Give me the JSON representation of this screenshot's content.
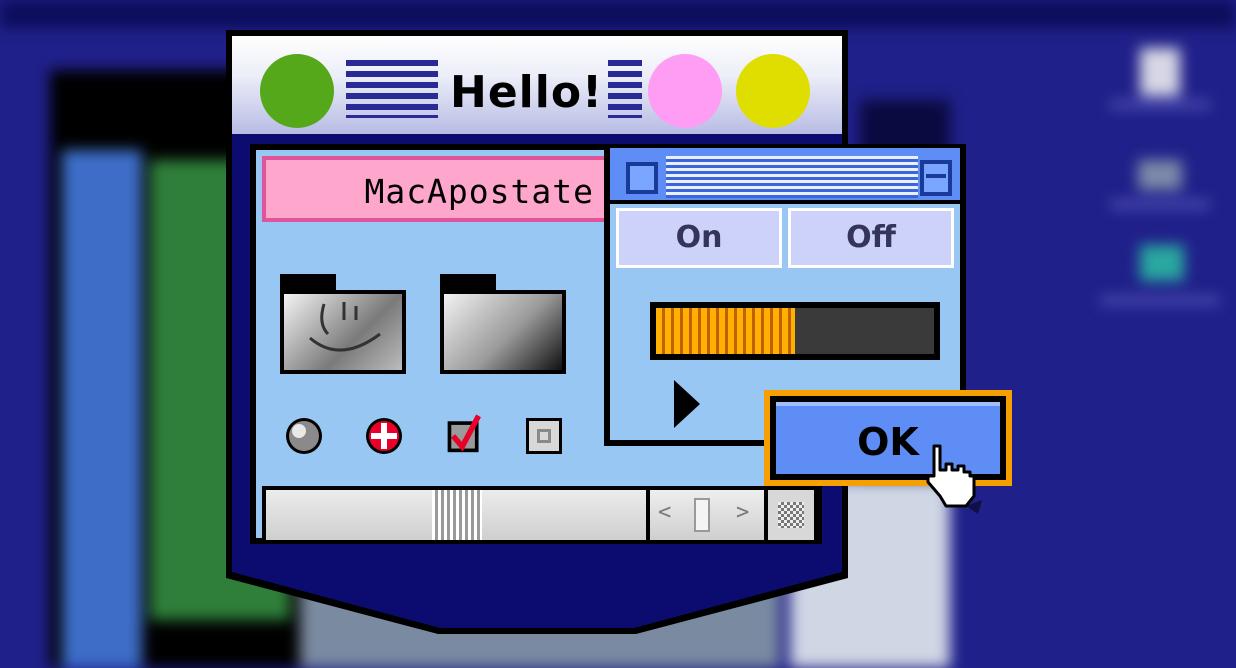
{
  "window": {
    "title": "Hello!",
    "buttons": [
      "close",
      "minimize",
      "zoom"
    ],
    "colors": {
      "close": "#55a81a",
      "minimize": "#ff9df5",
      "zoom": "#e0dd00",
      "accent": "#5e8ef5",
      "highlight": "#f5a000"
    }
  },
  "nameplate": {
    "label": "MacApostate"
  },
  "icons": [
    "finder-folder-icon",
    "folder-icon",
    "radio-ball-icon",
    "red-cross-icon",
    "checkbox-checked-icon",
    "checkbox-square-icon"
  ],
  "inner_window": {
    "segment": {
      "on_label": "On",
      "off_label": "Off"
    },
    "progress": {
      "value": 0.5
    },
    "play_icon": "play-icon"
  },
  "scrollbar": {
    "left_arrow": "<",
    "right_arrow": ">"
  },
  "ok_button": {
    "label": "OK"
  }
}
